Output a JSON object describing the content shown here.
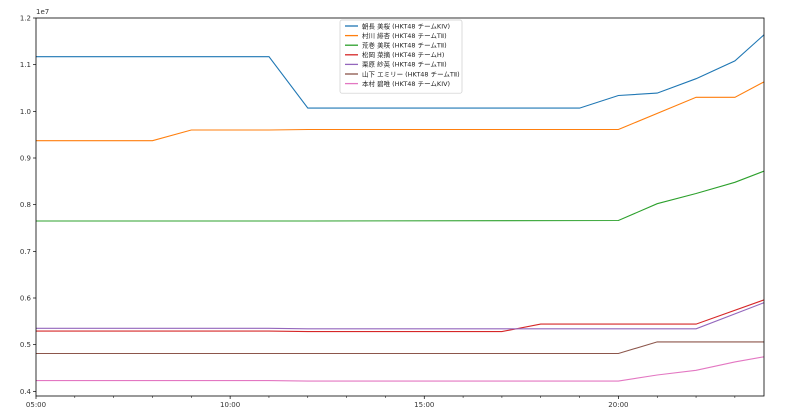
{
  "chart_data": {
    "type": "line",
    "scale_label": "1e7",
    "x_tick_labels": [
      "05:00",
      "10:00",
      "15:00",
      "20:00"
    ],
    "x_tick_values": [
      5,
      10,
      15,
      20
    ],
    "xlim": [
      5,
      23.75
    ],
    "y_tick_labels": [
      "0.4",
      "0.5",
      "0.6",
      "0.7",
      "0.8",
      "0.9",
      "1.0",
      "1.1",
      "1.2"
    ],
    "y_tick_values": [
      0.4,
      0.5,
      0.6,
      0.7,
      0.8,
      0.9,
      1.0,
      1.1,
      1.2
    ],
    "ylim": [
      0.39,
      1.2
    ],
    "grid": false,
    "legend_position": "top-center",
    "series": [
      {
        "name": "朝長 美桜 (HKT48 チームKIV)",
        "color": "#1f77b4",
        "points": [
          [
            5,
            1.117
          ],
          [
            11,
            1.117
          ],
          [
            12,
            1.007
          ],
          [
            19,
            1.007
          ],
          [
            20,
            1.034
          ],
          [
            21,
            1.039
          ],
          [
            22,
            1.07
          ],
          [
            23,
            1.108
          ],
          [
            23.75,
            1.164
          ]
        ]
      },
      {
        "name": "村川 緋杏 (HKT48 チームTⅡ)",
        "color": "#ff7f0e",
        "points": [
          [
            5,
            0.937
          ],
          [
            8,
            0.937
          ],
          [
            9,
            0.96
          ],
          [
            11,
            0.96
          ],
          [
            12,
            0.961
          ],
          [
            20,
            0.961
          ],
          [
            22,
            1.03
          ],
          [
            23,
            1.03
          ],
          [
            23.75,
            1.063
          ]
        ]
      },
      {
        "name": "荒巻 美咲 (HKT48 チームTⅡ)",
        "color": "#2ca02c",
        "points": [
          [
            5,
            0.765
          ],
          [
            12,
            0.765
          ],
          [
            20,
            0.766
          ],
          [
            21,
            0.802
          ],
          [
            22,
            0.824
          ],
          [
            23,
            0.848
          ],
          [
            23.75,
            0.872
          ]
        ]
      },
      {
        "name": "松岡 菜摘 (HKT48 チームH)",
        "color": "#d62728",
        "points": [
          [
            5,
            0.529
          ],
          [
            11,
            0.529
          ],
          [
            12,
            0.528
          ],
          [
            17,
            0.528
          ],
          [
            18,
            0.544
          ],
          [
            22,
            0.544
          ],
          [
            23.75,
            0.596
          ]
        ]
      },
      {
        "name": "栗原 紗英 (HKT48 チームTⅡ)",
        "color": "#9467bd",
        "points": [
          [
            5,
            0.535
          ],
          [
            11,
            0.535
          ],
          [
            12,
            0.534
          ],
          [
            22,
            0.534
          ],
          [
            23.75,
            0.59
          ]
        ]
      },
      {
        "name": "山下 エミリー (HKT48 チームTⅡ)",
        "color": "#8c564b",
        "points": [
          [
            5,
            0.481
          ],
          [
            20,
            0.481
          ],
          [
            21,
            0.506
          ],
          [
            23.75,
            0.506
          ]
        ]
      },
      {
        "name": "本村 碧唯 (HKT48 チームKIV)",
        "color": "#e377c2",
        "points": [
          [
            5,
            0.423
          ],
          [
            11,
            0.423
          ],
          [
            12,
            0.422
          ],
          [
            20,
            0.422
          ],
          [
            21,
            0.435
          ],
          [
            22,
            0.445
          ],
          [
            23,
            0.463
          ],
          [
            23.75,
            0.474
          ]
        ]
      }
    ]
  }
}
